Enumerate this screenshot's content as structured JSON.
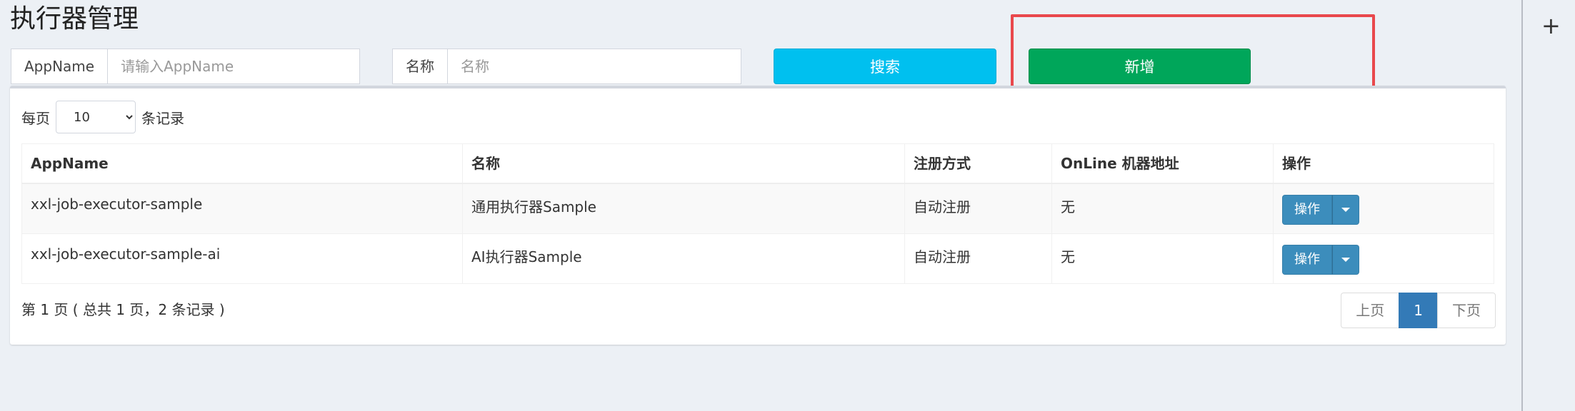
{
  "page": {
    "title": "执行器管理"
  },
  "filters": {
    "appname_label": "AppName",
    "appname_placeholder": "请输入AppName",
    "title_label": "名称",
    "title_placeholder": "名称",
    "search_label": "搜索",
    "add_label": "新增"
  },
  "length": {
    "prefix": "每页",
    "value": "10",
    "suffix": "条记录"
  },
  "table": {
    "headers": [
      "AppName",
      "名称",
      "注册方式",
      "OnLine 机器地址",
      "操作"
    ],
    "rows": [
      {
        "appname": "xxl-job-executor-sample",
        "title": "通用执行器Sample",
        "reg_type": "自动注册",
        "online": "无",
        "op": "操作"
      },
      {
        "appname": "xxl-job-executor-sample-ai",
        "title": "AI执行器Sample",
        "reg_type": "自动注册",
        "online": "无",
        "op": "操作"
      }
    ]
  },
  "footer": {
    "info": "第 1 页 ( 总共 1 页，2 条记录 )",
    "prev": "上页",
    "current": "1",
    "next": "下页"
  },
  "side": {
    "add_icon": "+"
  },
  "colors": {
    "search_button": "#00c0ef",
    "add_button": "#00a65a",
    "op_button": "#3c8dbc",
    "annotation": "#e9484c"
  }
}
